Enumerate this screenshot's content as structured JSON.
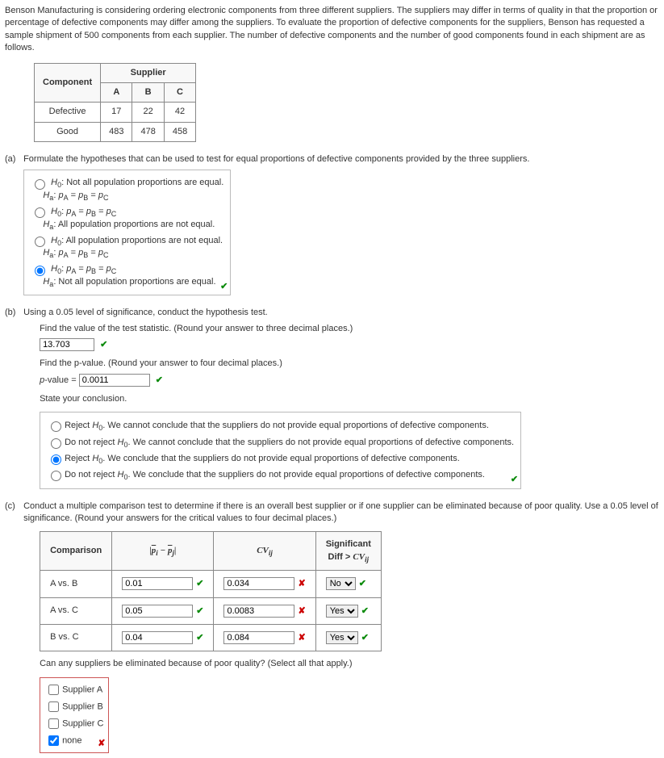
{
  "intro": "Benson Manufacturing is considering ordering electronic components from three different suppliers. The suppliers may differ in terms of quality in that the proportion or percentage of defective components may differ among the suppliers. To evaluate the proportion of defective components for the suppliers, Benson has requested a sample shipment of 500 components from each supplier. The number of defective components and the number of good components found in each shipment are as follows.",
  "data_table": {
    "corner": "Component",
    "sup_header": "Supplier",
    "cols": [
      "A",
      "B",
      "C"
    ],
    "rows": [
      {
        "label": "Defective",
        "vals": [
          "17",
          "22",
          "42"
        ]
      },
      {
        "label": "Good",
        "vals": [
          "483",
          "478",
          "458"
        ]
      }
    ]
  },
  "a": {
    "label": "(a)",
    "prompt": "Formulate the hypotheses that can be used to test for equal proportions of defective components provided by the three suppliers.",
    "opt1_l1": "H₀: Not all population proportions are equal.",
    "opt1_l2": "Hₐ: p_A = p_B = p_C",
    "opt2_l1": "H₀: p_A = p_B = p_C",
    "opt2_l2": "Hₐ: All population proportions are not equal.",
    "opt3_l1": "H₀: All population proportions are not equal.",
    "opt3_l2": "Hₐ: p_A = p_B = p_C",
    "opt4_l1": "H₀: p_A = p_B = p_C",
    "opt4_l2": "Hₐ: Not all population proportions are equal."
  },
  "b": {
    "label": "(b)",
    "prompt": "Using a 0.05 level of significance, conduct the hypothesis test.",
    "stat_prompt": "Find the value of the test statistic. (Round your answer to three decimal places.)",
    "stat_val": "13.703",
    "p_prompt": "Find the p-value. (Round your answer to four decimal places.)",
    "p_label": "p-value = ",
    "p_val": "0.0011",
    "conc_prompt": "State your conclusion.",
    "c1": "Reject H₀. We cannot conclude that the suppliers do not provide equal proportions of defective components.",
    "c2": "Do not reject H₀. We cannot conclude that the suppliers do not provide equal proportions of defective components.",
    "c3": "Reject H₀. We conclude that the suppliers do not provide equal proportions of defective components.",
    "c4": "Do not reject H₀. We conclude that the suppliers do not provide equal proportions of defective components."
  },
  "c": {
    "label": "(c)",
    "prompt": "Conduct a multiple comparison test to determine if there is an overall best supplier or if one supplier can be eliminated because of poor quality. Use a 0.05 level of significance. (Round your answers for the critical values to four decimal places.)",
    "headers": {
      "comp": "Comparison",
      "diff": "|p̄ᵢ − p̄ⱼ|",
      "cv": "CVᵢⱼ",
      "sig": "Significant\nDiff > CVᵢⱼ"
    },
    "rows": [
      {
        "comp": "A vs. B",
        "diff": "0.01",
        "diff_ok": true,
        "cv": "0.034",
        "cv_ok": false,
        "sig": "No",
        "sig_ok": true
      },
      {
        "comp": "A vs. C",
        "diff": "0.05",
        "diff_ok": true,
        "cv": "0.0083",
        "cv_ok": false,
        "sig": "Yes",
        "sig_ok": true
      },
      {
        "comp": "B vs. C",
        "diff": "0.04",
        "diff_ok": true,
        "cv": "0.084",
        "cv_ok": false,
        "sig": "Yes",
        "sig_ok": true
      }
    ],
    "elim_prompt": "Can any suppliers be eliminated because of poor quality? (Select all that apply.)",
    "elim": [
      "Supplier A",
      "Supplier B",
      "Supplier C",
      "none"
    ]
  }
}
